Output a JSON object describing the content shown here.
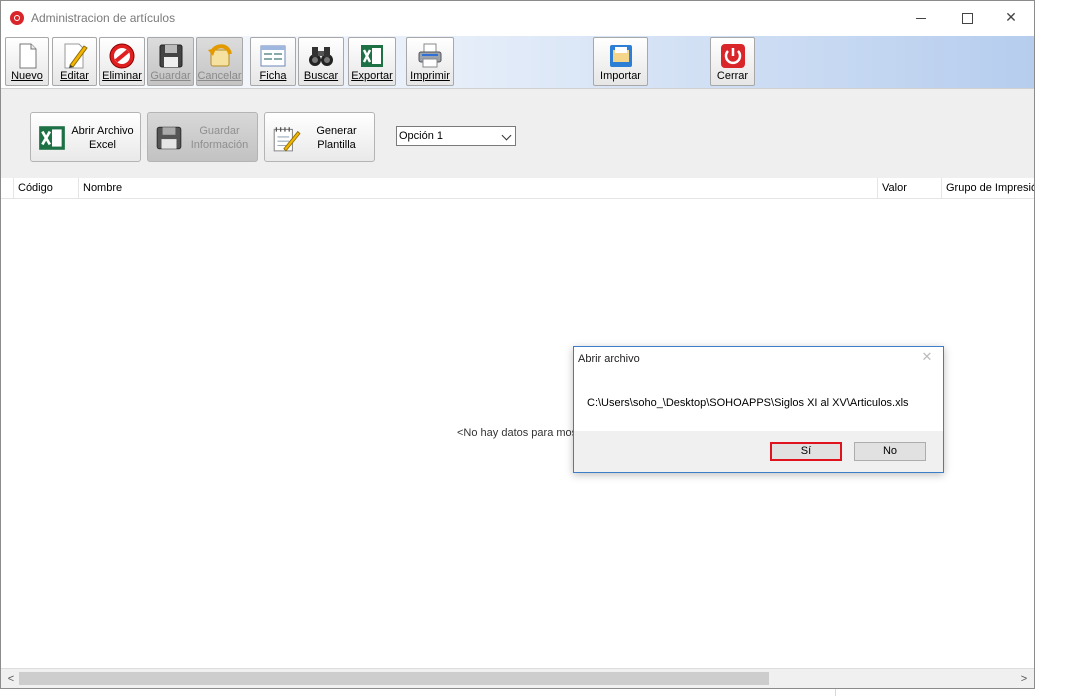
{
  "window": {
    "title": "Administracion de artículos"
  },
  "toolbar": {
    "buttons": [
      {
        "label": "Nuevo",
        "icon": "document-icon",
        "enabled": true
      },
      {
        "label": "Editar",
        "icon": "pencil-icon",
        "enabled": true
      },
      {
        "label": "Eliminar",
        "icon": "no-entry-icon",
        "enabled": true
      },
      {
        "label": "Guardar",
        "icon": "floppy-disk-icon",
        "enabled": false
      },
      {
        "label": "Cancelar",
        "icon": "undo-arrow-icon",
        "enabled": false
      },
      {
        "label": "Ficha",
        "icon": "form-icon",
        "enabled": true
      },
      {
        "label": "Buscar",
        "icon": "binoculars-icon",
        "enabled": true
      },
      {
        "label": "Exportar",
        "icon": "excel-icon",
        "enabled": true
      },
      {
        "label": "Imprimir",
        "icon": "printer-icon",
        "enabled": true
      },
      {
        "label": "Importar",
        "icon": "import-folder-icon",
        "enabled": true
      },
      {
        "label": "Cerrar",
        "icon": "power-icon",
        "enabled": true
      }
    ]
  },
  "actions": {
    "open_excel": {
      "line1": "Abrir Archivo",
      "line2": "Excel",
      "icon": "excel-icon",
      "enabled": true
    },
    "save_info": {
      "line1": "Guardar",
      "line2": "Información",
      "icon": "floppy-disk-icon",
      "enabled": false
    },
    "generate_template": {
      "line1": "Generar",
      "line2": "Plantilla",
      "icon": "notepad-pencil-icon",
      "enabled": true
    },
    "option_select": {
      "value": "Opción 1"
    }
  },
  "grid": {
    "columns": [
      "Código",
      "Nombre",
      "Valor",
      "Grupo de Impresión"
    ],
    "empty_message": "<No hay datos para most"
  },
  "dialog": {
    "title": "Abrir archivo",
    "message": "C:\\Users\\soho_\\Desktop\\SOHOAPPS\\Siglos XI al XV\\Articulos.xls",
    "yes_label": "Sí",
    "no_label": "No"
  },
  "colors": {
    "excel_green": "#1e7145",
    "close_red": "#d9262b",
    "dialog_border": "#3c7fc8",
    "highlight_red": "#e0121e"
  }
}
